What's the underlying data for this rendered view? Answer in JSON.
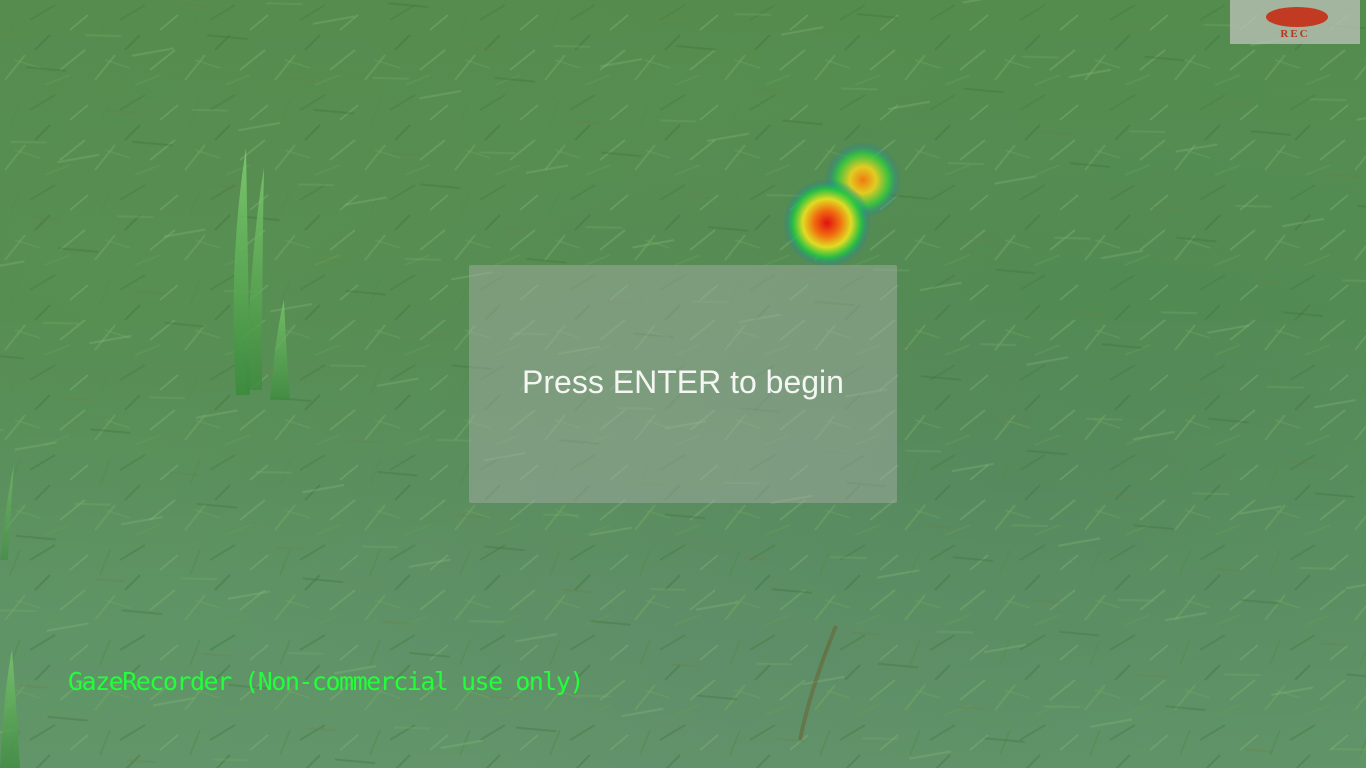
{
  "recorder": {
    "rec_label": "REC",
    "rec_color": "#c23a22",
    "status": "recording"
  },
  "dialog": {
    "prompt": "Press ENTER to begin"
  },
  "watermark": {
    "text": "GazeRecorder (Non-commercial use only)",
    "color": "#22ff3a"
  },
  "scene": {
    "background": "grass-field",
    "overlay": "gaze-heatmap"
  }
}
